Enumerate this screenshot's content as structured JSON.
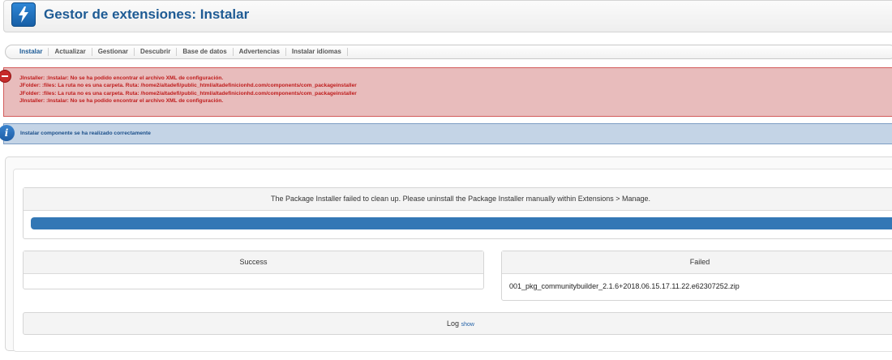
{
  "header": {
    "title": "Gestor de extensiones: Instalar",
    "logo_icon": "joomla-bolt-icon"
  },
  "tabs": [
    {
      "label": "Instalar",
      "active": true
    },
    {
      "label": "Actualizar"
    },
    {
      "label": "Gestionar"
    },
    {
      "label": "Descubrir"
    },
    {
      "label": "Base de datos"
    },
    {
      "label": "Advertencias"
    },
    {
      "label": "Instalar idiomas"
    }
  ],
  "error_alert": {
    "icon": "error-icon",
    "lines": [
      "JInstaller: :Instalar: No se ha podido encontrar el archivo XML de configuración.",
      "JFolder: :files: La ruta no es una carpeta. Ruta: /home2/altadefi/public_html/altadefinicionhd.com/components/com_packageinstaller",
      "JFolder: :files: La ruta no es una carpeta. Ruta: /home2/altadefi/public_html/altadefinicionhd.com/components/com_packageinstaller",
      "JInstaller: :Instalar: No se ha podido encontrar el archivo XML de configuración."
    ]
  },
  "info_alert": {
    "icon": "info-icon",
    "text": "Instalar componente se ha realizado correctamente"
  },
  "installer": {
    "message": "The Package Installer failed to clean up. Please uninstall the Package Installer manually within Extensions > Manage.",
    "progress": 1.0,
    "success_header": "Success",
    "failed_header": "Failed",
    "failed_items": [
      "001_pkg_communitybuilder_2.1.6+2018.06.15.17.11.22.e62307252.zip"
    ],
    "log_label": "Log",
    "log_link": "show"
  },
  "colors": {
    "accent": "#1e5b94",
    "error": "#bf1d1d",
    "progress": "#3377b5"
  }
}
